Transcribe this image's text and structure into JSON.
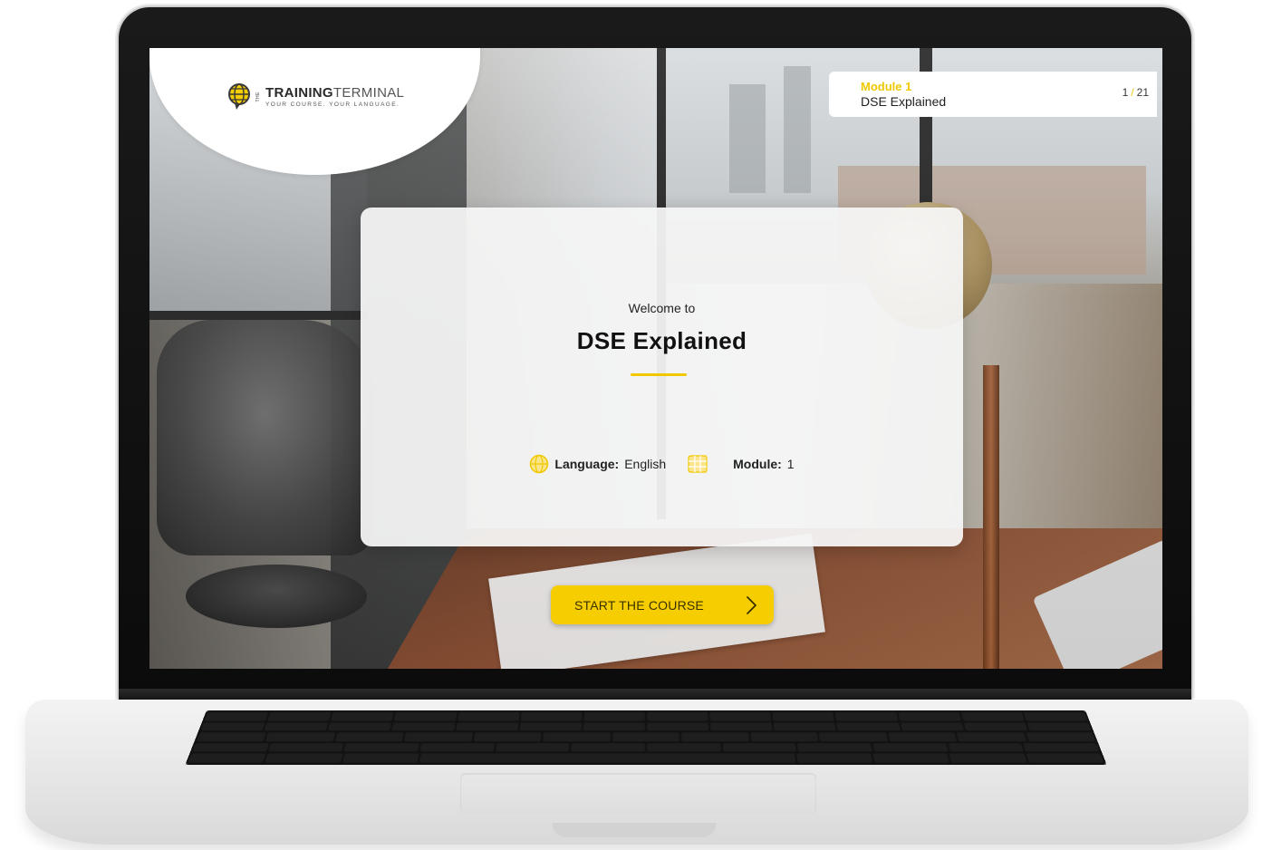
{
  "logo": {
    "prefix": "THE",
    "name_bold": "TRAINING",
    "name_light": "TERMINAL",
    "tagline": "YOUR COURSE. YOUR LANGUAGE.",
    "icon": "globe-chat-icon"
  },
  "module_panel": {
    "label": "Module 1",
    "title": "DSE Explained",
    "current": "1",
    "separator": "/",
    "total": "21"
  },
  "welcome": {
    "pre_title": "Welcome to",
    "title": "DSE Explained",
    "language_label": "Language:",
    "language_value": "English",
    "language_icon": "globe-icon",
    "module_label": "Module:",
    "module_value": "1",
    "module_icon": "grid-icon"
  },
  "cta": {
    "label": "START THE COURSE",
    "icon": "chevron-right-icon"
  },
  "colors": {
    "accent": "#f0c800",
    "cta_bg": "#f5cd00",
    "text": "#222222"
  }
}
